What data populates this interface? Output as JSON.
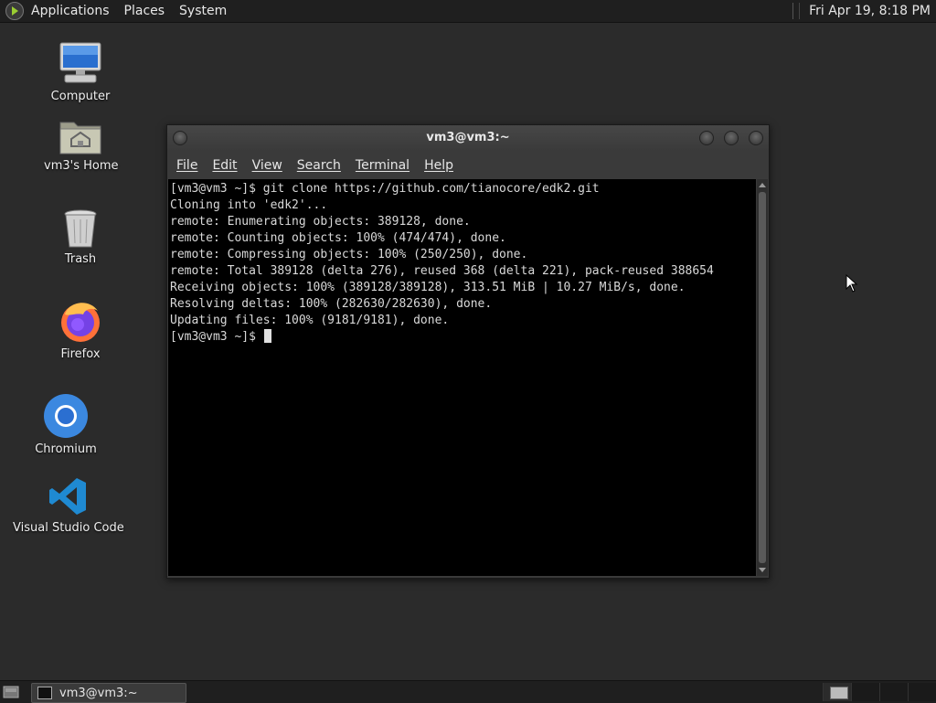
{
  "top_panel": {
    "menus": [
      "Applications",
      "Places",
      "System"
    ],
    "clock": "Fri Apr 19,  8:18 PM"
  },
  "desktop_icons": [
    {
      "label": "Computer",
      "icon": "computer-icon"
    },
    {
      "label": "vm3's Home",
      "icon": "home-folder-icon"
    },
    {
      "label": "Trash",
      "icon": "trash-icon"
    },
    {
      "label": "Firefox",
      "icon": "firefox-icon"
    },
    {
      "label": "Chromium",
      "icon": "chromium-icon"
    },
    {
      "label": "Visual Studio Code",
      "icon": "vscode-icon"
    }
  ],
  "terminal": {
    "title": "vm3@vm3:~",
    "menus": [
      "File",
      "Edit",
      "View",
      "Search",
      "Terminal",
      "Help"
    ],
    "lines": [
      "[vm3@vm3 ~]$ git clone https://github.com/tianocore/edk2.git",
      "Cloning into 'edk2'...",
      "remote: Enumerating objects: 389128, done.",
      "remote: Counting objects: 100% (474/474), done.",
      "remote: Compressing objects: 100% (250/250), done.",
      "remote: Total 389128 (delta 276), reused 368 (delta 221), pack-reused 388654",
      "Receiving objects: 100% (389128/389128), 313.51 MiB | 10.27 MiB/s, done.",
      "Resolving deltas: 100% (282630/282630), done.",
      "Updating files: 100% (9181/9181), done."
    ],
    "prompt": "[vm3@vm3 ~]$ "
  },
  "bottom_panel": {
    "task": "vm3@vm3:~"
  }
}
